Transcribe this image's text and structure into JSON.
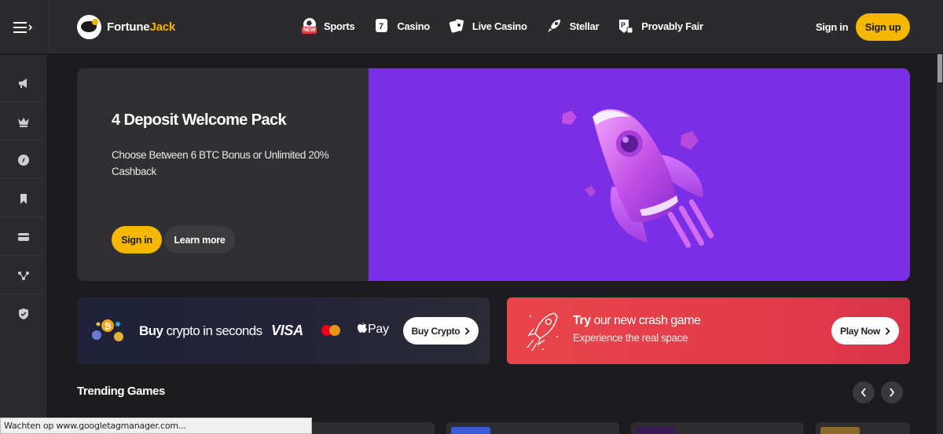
{
  "header": {
    "logo": {
      "part1": "Fortune",
      "part2": "Jack"
    },
    "nav": [
      {
        "label": "Sports",
        "icon": "soccer-ball-icon",
        "badge": "NEW"
      },
      {
        "label": "Casino",
        "icon": "slot-seven-icon"
      },
      {
        "label": "Live Casino",
        "icon": "cards-icon"
      },
      {
        "label": "Stellar",
        "icon": "rocket-icon"
      },
      {
        "label": "Provably Fair",
        "icon": "provably-fair-icon"
      }
    ],
    "sign_in": "Sign in",
    "sign_up": "Sign up"
  },
  "sidebar": {
    "items": [
      {
        "icon": "megaphone-icon"
      },
      {
        "icon": "crown-icon"
      },
      {
        "icon": "compass-icon"
      },
      {
        "icon": "bookmark-icon"
      },
      {
        "icon": "card-icon"
      },
      {
        "icon": "network-icon"
      },
      {
        "icon": "shield-icon"
      }
    ]
  },
  "hero": {
    "title": "4 Deposit Welcome Pack",
    "description": "Choose Between 6 BTC Bonus or Unlimited 20% Cashback",
    "sign_in": "Sign in",
    "learn_more": "Learn more",
    "image": "purple-rocket-illustration",
    "bg_color": "#7a2fe6"
  },
  "crypto_card": {
    "text_bold": "Buy",
    "text_rest": " crypto in seconds",
    "visa": "VISA",
    "apple_pay": "Pay",
    "button": "Buy Crypto"
  },
  "crash_card": {
    "title_bold": "Try",
    "title_rest": " our new crash game",
    "subtitle": "Experience the real space",
    "button": "Play Now"
  },
  "trending": {
    "title": "Trending Games"
  },
  "status_bar": "Wachten op www.googletagmanager.com...",
  "colors": {
    "accent": "#f6b700",
    "crash_red": "#e8454a",
    "hero_purple": "#7a2fe6"
  }
}
